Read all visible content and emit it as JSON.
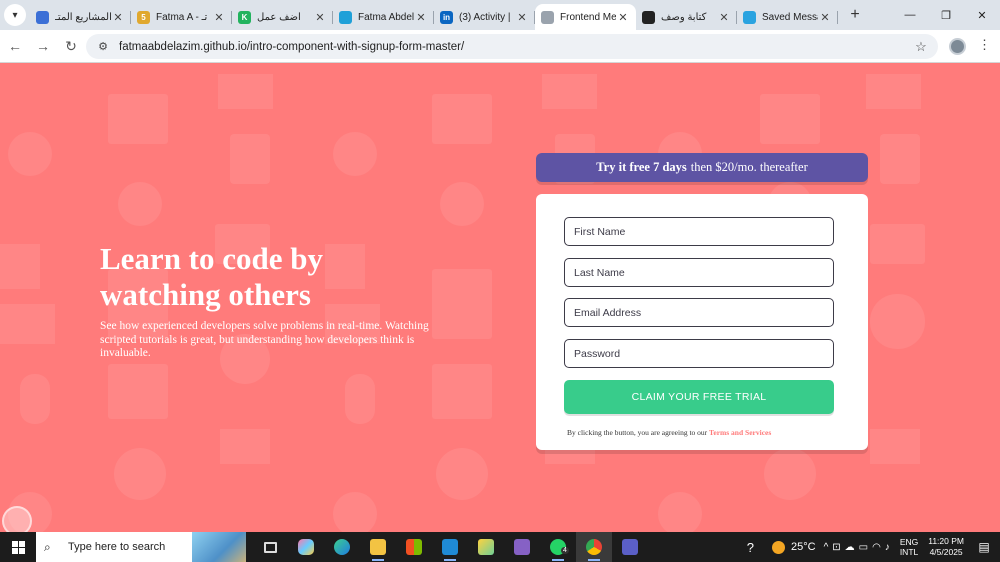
{
  "browser": {
    "tabs": [
      {
        "title": "المشاريع المتـ",
        "favicon_color": "#3b6fd6",
        "active": false
      },
      {
        "title": "Fatma A - تـ",
        "favicon_color": "#e0a82e",
        "favicon_text": "5",
        "active": false
      },
      {
        "title": "أضف عمل",
        "favicon_color": "#22b35e",
        "favicon_text": "K",
        "active": false
      },
      {
        "title": "Fatma Abdel",
        "favicon_color": "#1fa0d8",
        "active": false
      },
      {
        "title": "(3) Activity |",
        "favicon_color": "#0a66c2",
        "favicon_text": "in",
        "active": false
      },
      {
        "title": "Frontend Me",
        "favicon_color": "#9aa3ad",
        "active": true
      },
      {
        "title": "كتابة وصف",
        "favicon_color": "#222222",
        "active": false
      },
      {
        "title": "Saved Messa",
        "favicon_color": "#2aa3e0",
        "active": false
      }
    ],
    "tab_close": "✕",
    "new_tab": "+",
    "url": "fatmaabdelazim.github.io/intro-component-with-signup-form-master/",
    "icons": {
      "back": "back-arrow-icon",
      "forward": "forward-arrow-icon",
      "reload": "reload-icon",
      "bookmark": "star-icon"
    }
  },
  "page": {
    "hero": {
      "title": "Learn to code by watching others",
      "description": "See how experienced developers solve problems in real-time. Watching scripted tutorials is great, but understanding how developers think is invaluable."
    },
    "promo": {
      "bold": "Try it free 7 days",
      "rest": "then $20/mo. thereafter"
    },
    "form": {
      "first_name_placeholder": "First Name",
      "last_name_placeholder": "Last Name",
      "email_placeholder": "Email Address",
      "password_placeholder": "Password",
      "submit_label": "CLAIM YOUR FREE TRIAL",
      "terms_prefix": "By clicking the button, you are agreeing to our",
      "terms_link": "Terms and Services"
    },
    "colors": {
      "background": "#ff7a7a",
      "accent_purple": "#5e54a4",
      "accent_green": "#38cc8b"
    }
  },
  "taskbar": {
    "search_placeholder": "Type here to search",
    "weather": "25°C",
    "language": "ENG",
    "layout": "INTL",
    "time": "11:20 PM",
    "date": "4/5/2025",
    "whatsapp_badge": "4"
  }
}
